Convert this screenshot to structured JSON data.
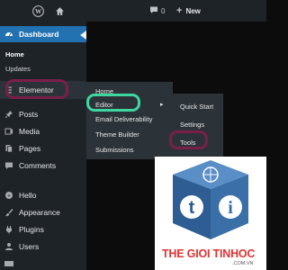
{
  "topbar": {
    "comment_count": "0",
    "new_label": "New"
  },
  "sidebar": {
    "dashboard_label": "Dashboard",
    "dashboard_sub": [
      "Home",
      "Updates"
    ],
    "items": [
      {
        "label": "Elementor",
        "icon": "elementor-icon"
      },
      {
        "label": "Posts",
        "icon": "pin-icon"
      },
      {
        "label": "Media",
        "icon": "media-icon"
      },
      {
        "label": "Pages",
        "icon": "pages-icon"
      },
      {
        "label": "Comments",
        "icon": "comment-icon"
      },
      {
        "label": "Hello",
        "icon": "hello-icon"
      },
      {
        "label": "Appearance",
        "icon": "brush-icon"
      },
      {
        "label": "Plugins",
        "icon": "plugin-icon"
      },
      {
        "label": "Users",
        "icon": "user-icon"
      }
    ]
  },
  "elementor_flyout": {
    "items": [
      "Home",
      "Editor",
      "Email Deliverability",
      "Theme Builder",
      "Submissions"
    ]
  },
  "editor_flyout": {
    "items": [
      "Quick Start",
      "Settings",
      "Tools"
    ]
  },
  "watermark": {
    "brand": "THE GIOI TINHOC",
    "domain": ".COM.VN"
  },
  "colors": {
    "accent": "#2271b1",
    "highlight_ring": "#7a1f4a",
    "editor_ring": "#3fd6a0",
    "sidebar_bg": "#1d2327",
    "flyout_bg": "#2c3338",
    "brand_red": "#e03131"
  }
}
